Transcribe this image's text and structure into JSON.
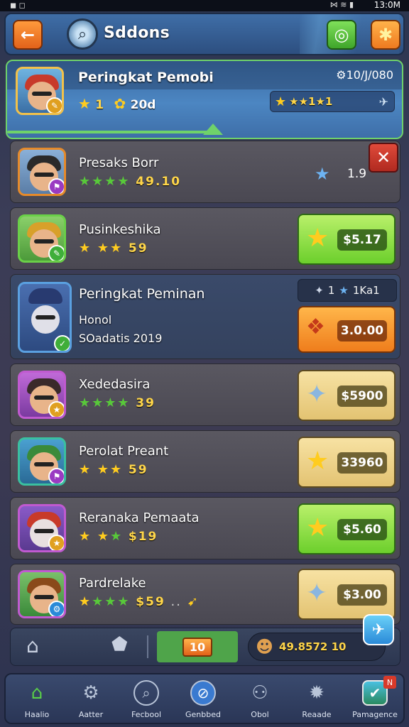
{
  "status_bar": {
    "time": "13:0M",
    "left_icons": "◼ ◻",
    "right_icons": "⋈ ≋ ▮"
  },
  "header": {
    "title": "Sddons",
    "back_icon": "back-arrow-icon",
    "search_icon": "search-icon",
    "chat_icon": "chat-icon",
    "puzzle_icon": "puzzle-icon"
  },
  "profile": {
    "title": "Peringkat Pemobi",
    "currency_text": "10/J/080",
    "star_count": "1",
    "star_value": "20d",
    "rank_text": "★★1★1"
  },
  "rows": [
    {
      "name": "Presaks Borr",
      "score": "49.10",
      "stars_green": 4,
      "right_label": "1.9",
      "action": "close"
    },
    {
      "name": "Pusinkeshika",
      "score": "59",
      "price": "$5.17",
      "btn": "green"
    },
    {
      "name": "Peringkat Peminan",
      "sub1": "Honol",
      "sub2": "SOadatis 2019",
      "badge_text": "1",
      "badge_text2": "1Ka1",
      "price": "3.0.00",
      "btn": "orange"
    },
    {
      "name": "Xededasira",
      "score": "39",
      "price": "$5900",
      "btn": "gold"
    },
    {
      "name": "Perolat Preant",
      "score": "59",
      "price": "33960",
      "btn": "gold"
    },
    {
      "name": "Reranaka Pemaata",
      "score": "$19",
      "price": "$5.60",
      "btn": "green"
    },
    {
      "name": "Pardrelake",
      "score": "$59",
      "extra": "..",
      "price": "$3.00",
      "btn": "gold"
    }
  ],
  "sub_bar": {
    "mid_label": "10",
    "coins": "49.8572 10"
  },
  "nav": [
    {
      "label": "Haalio",
      "icon": "home-icon"
    },
    {
      "label": "Aatter",
      "icon": "gear-icon"
    },
    {
      "label": "Fecbool",
      "icon": "search-icon"
    },
    {
      "label": "Genbbed",
      "icon": "compass-icon"
    },
    {
      "label": "Obol",
      "icon": "robot-icon"
    },
    {
      "label": "Reaade",
      "icon": "cog-icon"
    },
    {
      "label": "Pamagence",
      "icon": "shield-icon"
    }
  ]
}
